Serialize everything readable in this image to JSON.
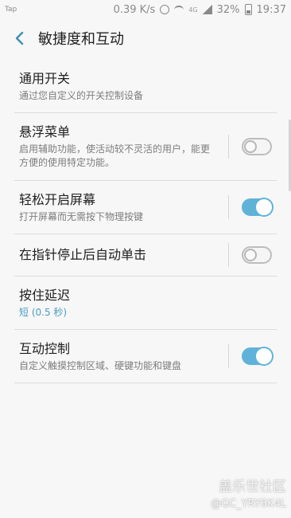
{
  "status_bar": {
    "left_label": "Tap",
    "speed": "0.39 K/s",
    "network": "4G",
    "battery": "32%",
    "time": "19:37"
  },
  "header": {
    "title": "敏捷度和互动"
  },
  "items": [
    {
      "title": "通用开关",
      "subtitle": "通过您自定义的开关控制设备"
    },
    {
      "title": "悬浮菜单",
      "subtitle": "启用辅助功能，使活动较不灵活的用户，能更方便的使用特定功能。",
      "toggle": false
    },
    {
      "title": "轻松开启屏幕",
      "subtitle": "打开屏幕而无需按下物理按键",
      "toggle": true
    },
    {
      "title": "在指针停止后自动单击",
      "toggle": false
    },
    {
      "title": "按住延迟",
      "subtitle": "短 (0.5 秒)"
    },
    {
      "title": "互动控制",
      "subtitle": "自定义触摸控制区域、硬键功能和键盘",
      "toggle": true
    }
  ],
  "colors": {
    "accent": "#5fb3d9",
    "accent_text": "#4a9cc2"
  },
  "watermark": {
    "line1": "盖乐世社区",
    "line2": "@GC_YRY6K4L"
  }
}
